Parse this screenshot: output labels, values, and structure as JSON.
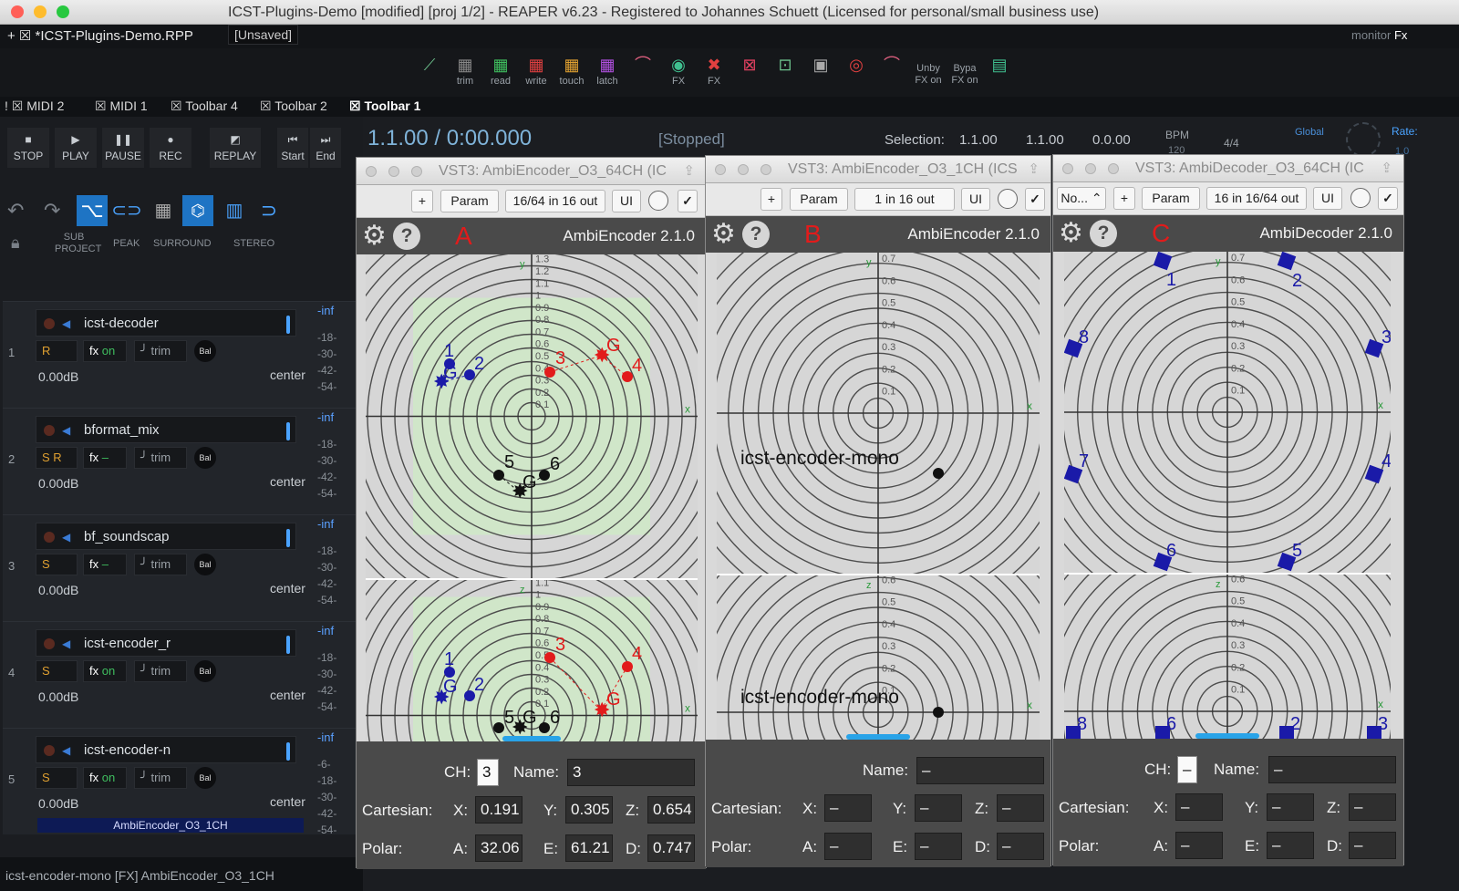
{
  "window": {
    "title": "ICST-Plugins-Demo [modified] [proj 1/2] - REAPER v6.23 - Registered to Johannes Schuett (Licensed for personal/small business use)"
  },
  "project_tab": {
    "name": "*ICST-Plugins-Demo.RPP",
    "unsaved": "[Unsaved]",
    "monitor": "monitor"
  },
  "toolbar": {
    "buttons": [
      "trim",
      "read",
      "write",
      "touch",
      "latch",
      "FX",
      "FX",
      "Unby FX on",
      "Bypa FX on"
    ]
  },
  "tabs": [
    "MIDI 2",
    "MIDI 1",
    "Toolbar 4",
    "Toolbar 2",
    "Toolbar 1"
  ],
  "transport": {
    "buttons": [
      "STOP",
      "PLAY",
      "PAUSE",
      "REC",
      "REPLAY",
      "Start",
      "End"
    ],
    "tools": [
      "SUB PROJECT",
      "PEAK",
      "SURROUND",
      "STEREO"
    ],
    "time": "1.1.00 / 0:00.000",
    "state": "[Stopped]",
    "selection_label": "Selection:",
    "selection": [
      "1.1.00",
      "1.1.00",
      "0.0.00"
    ],
    "bpm_label": "BPM",
    "bpm": "120",
    "signature": "4/4",
    "global": "Global",
    "rate_label": "Rate:",
    "rate": "1.0"
  },
  "tracks": [
    {
      "num": "1",
      "name": "icst-decoder",
      "vol": "0.00dB",
      "pan": "center",
      "fx": "fx",
      "fxstate": "on",
      "trim": "trim",
      "bal": "Bal",
      "mode": "R"
    },
    {
      "num": "2",
      "name": "bformat_mix",
      "vol": "0.00dB",
      "pan": "center",
      "fx": "fx",
      "fxstate": "–",
      "trim": "trim",
      "bal": "Bal",
      "mode": "S R"
    },
    {
      "num": "3",
      "name": "bf_soundscap",
      "vol": "0.00dB",
      "pan": "center",
      "fx": "fx",
      "fxstate": "–",
      "trim": "trim",
      "bal": "Bal",
      "mode": "S"
    },
    {
      "num": "4",
      "name": "icst-encoder_r",
      "vol": "0.00dB",
      "pan": "center",
      "fx": "fx",
      "fxstate": "on",
      "trim": "trim",
      "bal": "Bal",
      "mode": "S"
    },
    {
      "num": "5",
      "name": "icst-encoder-n",
      "vol": "0.00dB",
      "pan": "center",
      "fx": "fx",
      "fxstate": "on",
      "trim": "trim",
      "bal": "Bal",
      "mode": "S",
      "plugin": "AmbiEncoder_O3_1CH"
    }
  ],
  "meter_labels": [
    "-inf",
    "-18-",
    "-30-",
    "-42-",
    "-54-"
  ],
  "meter_labels_last": [
    "-inf",
    "-6-",
    "-18-",
    "-30-",
    "-42-",
    "-54-"
  ],
  "statusbar": "icst-encoder-mono [FX] AmbiEncoder_O3_1CH",
  "plugins": [
    {
      "title": "VST3: AmbiEncoder_O3_64CH (IC",
      "letter": "A",
      "version": "AmbiEncoder 2.1.0",
      "io": "16/64 in 16 out",
      "param": "Param",
      "ui": "UI",
      "add": "+",
      "ch_label": "CH:",
      "ch": "3",
      "name_label": "Name:",
      "name": "3",
      "cart_label": "Cartesian:",
      "x": "0.191",
      "y": "0.305",
      "z": "0.654",
      "polar_label": "Polar:",
      "a": "32.06",
      "e": "61.21",
      "d": "0.747"
    },
    {
      "title": "VST3: AmbiEncoder_O3_1CH (ICS",
      "letter": "B",
      "version": "AmbiEncoder 2.1.0",
      "io": "1 in 16 out",
      "param": "Param",
      "ui": "UI",
      "add": "+",
      "name_label": "Name:",
      "name": "–",
      "cart_label": "Cartesian:",
      "x": "–",
      "y": "–",
      "z": "–",
      "polar_label": "Polar:",
      "a": "–",
      "e": "–",
      "d": "–",
      "source_label": "icst-encoder-mono"
    },
    {
      "title": "VST3: AmbiDecoder_O3_64CH (IC",
      "letter": "C",
      "version": "AmbiDecoder 2.1.0",
      "io": "16 in 16/64 out",
      "preset": "No...",
      "param": "Param",
      "ui": "UI",
      "add": "+",
      "ch_label": "CH:",
      "ch": "–",
      "name_label": "Name:",
      "name": "–",
      "cart_label": "Cartesian:",
      "x": "–",
      "y": "–",
      "z": "–",
      "polar_label": "Polar:",
      "a": "–",
      "e": "–",
      "d": "–"
    }
  ],
  "axis": {
    "x": "x",
    "y": "y",
    "z": "z",
    "ticks_a": [
      "1.3",
      "1.2",
      "1.1",
      "1",
      "0.9",
      "0.8",
      "0.7",
      "0.6",
      "0.5",
      "0.4",
      "0.3",
      "0.2",
      "0.1"
    ],
    "ticks_b": [
      "0.9",
      "0.8",
      "0.7",
      "0.6",
      "0.5",
      "0.4",
      "0.3",
      "0.2",
      "0.1"
    ]
  },
  "enc_a_points": {
    "top": [
      "1",
      "2",
      "3",
      "4",
      "5",
      "6",
      "G",
      "G",
      "G"
    ],
    "bottom": [
      "1",
      "2",
      "3",
      "4",
      "5",
      "6",
      "G",
      "G",
      "G"
    ]
  },
  "speakers": [
    "1",
    "2",
    "3",
    "4",
    "5",
    "6",
    "7",
    "8"
  ],
  "speakers_bottom": [
    "8",
    "6",
    "2",
    "3"
  ],
  "labels": {
    "x_l": "X:",
    "y_l": "Y:",
    "z_l": "Z:",
    "a_l": "A:",
    "e_l": "E:",
    "d_l": "D:"
  },
  "colors": {
    "red": "#e21b1b",
    "blue": "#1a1aa8",
    "green_zone": "#cfe8c8",
    "accent": "#4aa3ff"
  }
}
